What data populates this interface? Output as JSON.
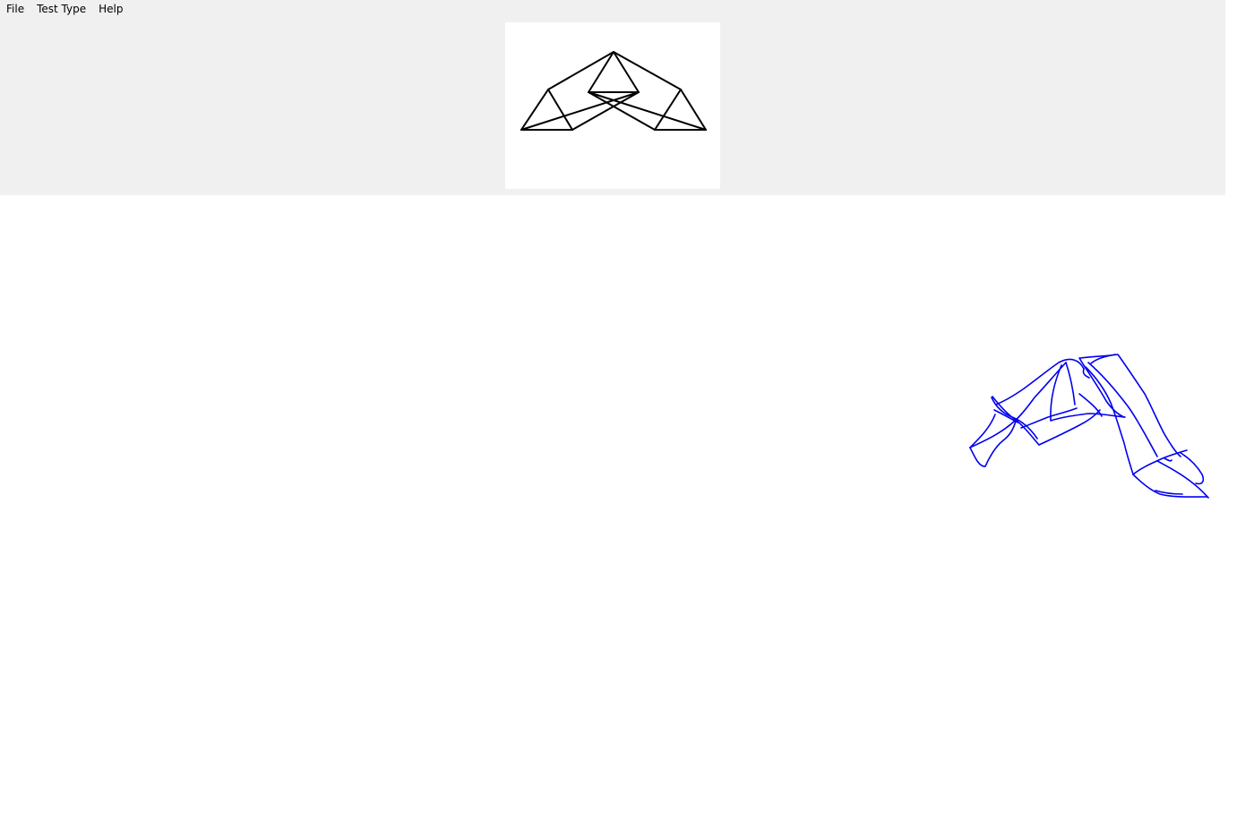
{
  "menubar": {
    "items": [
      {
        "label": "File"
      },
      {
        "label": "Test Type"
      },
      {
        "label": "Help"
      }
    ]
  },
  "reference_figure": {
    "stroke_color": "#000000"
  },
  "drawing_canvas": {
    "ink_color": "#0000ee"
  }
}
